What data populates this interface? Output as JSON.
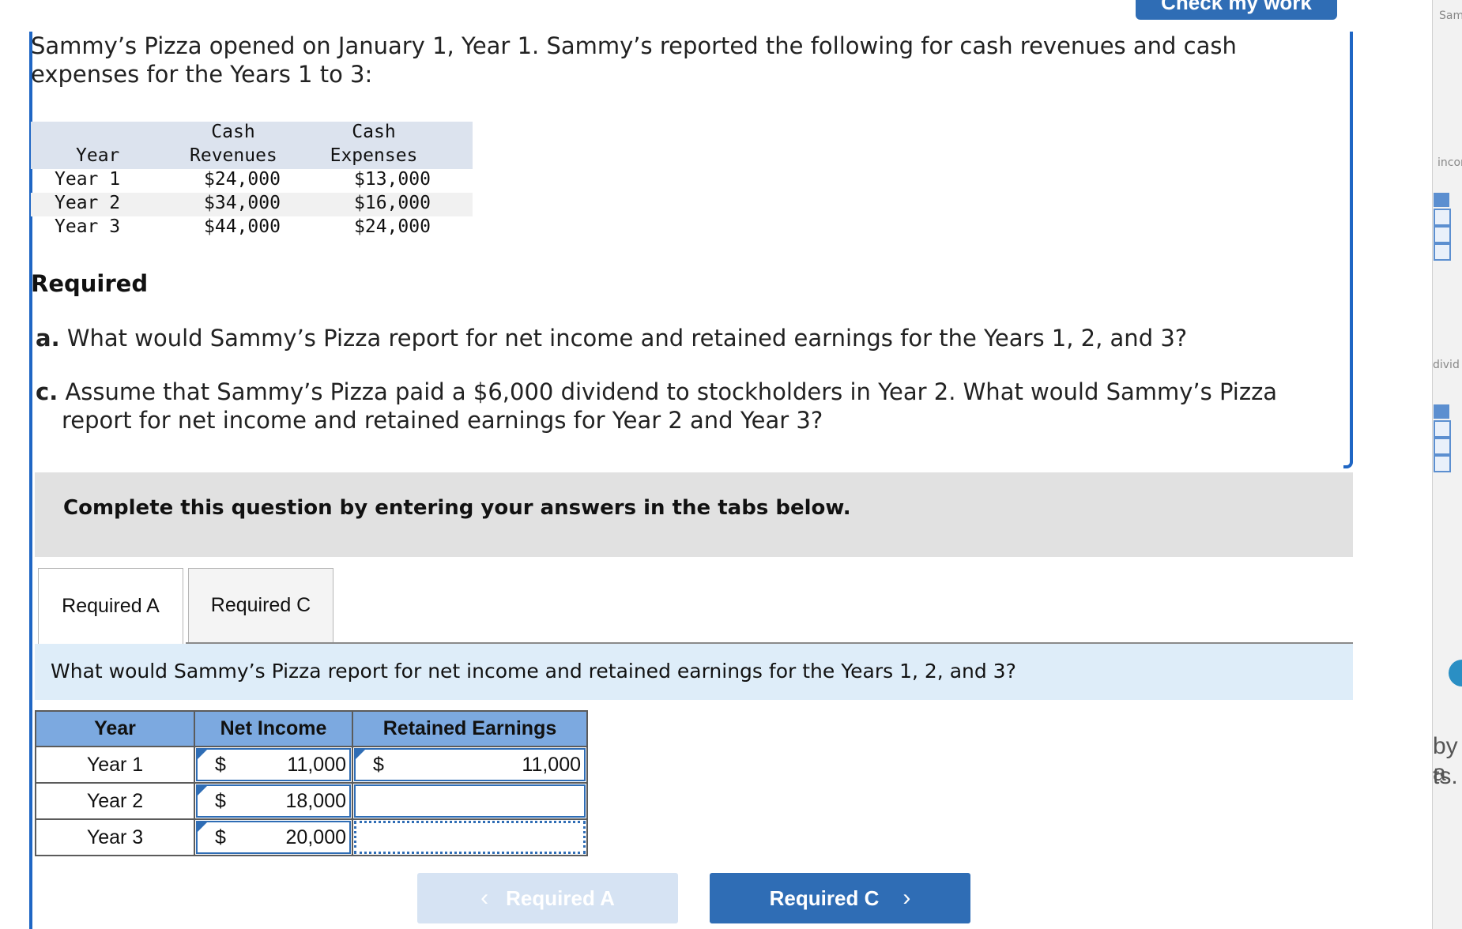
{
  "header": {
    "check_button_label": "Check my work"
  },
  "problem": {
    "intro": "Sammy’s Pizza opened on January 1, Year 1. Sammy’s reported the following for cash revenues and cash expenses for the Years 1 to 3:",
    "table": {
      "headers": {
        "year": "Year",
        "rev_top": "Cash",
        "rev_bottom": "Revenues",
        "exp_top": "Cash",
        "exp_bottom": "Expenses"
      },
      "rows": [
        {
          "year": "Year 1",
          "revenues": "$24,000",
          "expenses": "$13,000"
        },
        {
          "year": "Year 2",
          "revenues": "$34,000",
          "expenses": "$16,000"
        },
        {
          "year": "Year 3",
          "revenues": "$44,000",
          "expenses": "$24,000"
        }
      ]
    },
    "required_title": "Required",
    "req_a_letter": "a.",
    "req_a_text": "What would Sammy’s Pizza report for net income and retained earnings for the Years 1, 2, and 3?",
    "req_c_letter": "c.",
    "req_c_text": "Assume that Sammy’s Pizza paid a $6,000 dividend to stockholders in Year 2. What would Sammy’s Pizza report for net income and retained earnings for Year 2 and Year 3?"
  },
  "instructions": "Complete this question by entering your answers in the tabs below.",
  "tabs": [
    {
      "label": "Required A",
      "active": true
    },
    {
      "label": "Required C",
      "active": false
    }
  ],
  "question": "What would Sammy’s Pizza report for net income and retained earnings for the Years 1, 2, and 3?",
  "answer_table": {
    "headers": {
      "year": "Year",
      "net_income": "Net Income",
      "retained_earnings": "Retained Earnings"
    },
    "rows": [
      {
        "year": "Year 1",
        "ni_symbol": "$",
        "ni_value": "11,000",
        "re_symbol": "$",
        "re_value": "11,000"
      },
      {
        "year": "Year 2",
        "ni_symbol": "$",
        "ni_value": "18,000",
        "re_symbol": "",
        "re_value": ""
      },
      {
        "year": "Year 3",
        "ni_symbol": "$",
        "ni_value": "20,000",
        "re_symbol": "",
        "re_value": ""
      }
    ]
  },
  "nav": {
    "prev_label": "Required A",
    "next_label": "Required C",
    "prev_chevron": "‹",
    "next_chevron": "›"
  },
  "side_panel": {
    "text_1": "Sam",
    "text_2": "incor",
    "text_3": "divid",
    "text_4": "by a",
    "text_5": "ts."
  },
  "colors": {
    "accent": "#2f6db5",
    "header_blue": "#7ca9e0",
    "band": "#deedf9",
    "rail": "#1f66c4"
  }
}
